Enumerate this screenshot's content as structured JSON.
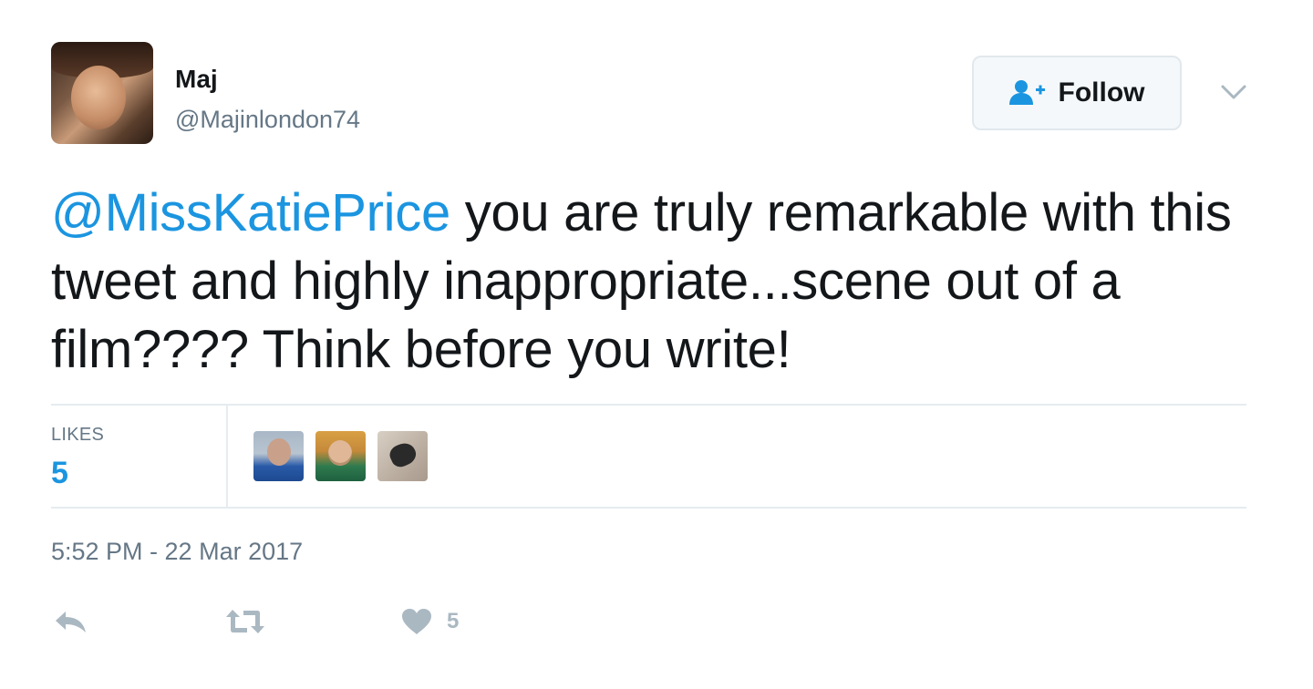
{
  "author": {
    "name": "Maj",
    "handle": "@Majinlondon74"
  },
  "follow_button": {
    "label": "Follow",
    "icon": "follow-user-icon"
  },
  "menu": {
    "icon": "chevron-down-icon"
  },
  "tweet": {
    "mention": "@MissKatiePrice",
    "text": " you are truly remarkable with this tweet and highly inappropriate...scene out of a film???? Think before you write!"
  },
  "stats": {
    "likes_label": "LIKES",
    "likes_count": "5"
  },
  "timestamp": "5:52 PM - 22 Mar 2017",
  "actions": {
    "reply_icon": "reply-icon",
    "retweet_icon": "retweet-icon",
    "like_icon": "heart-icon",
    "like_count": "5"
  },
  "colors": {
    "link": "#1b95e0",
    "muted": "#657786",
    "border": "#e6ecf0",
    "action_icon": "#aab8c2"
  }
}
